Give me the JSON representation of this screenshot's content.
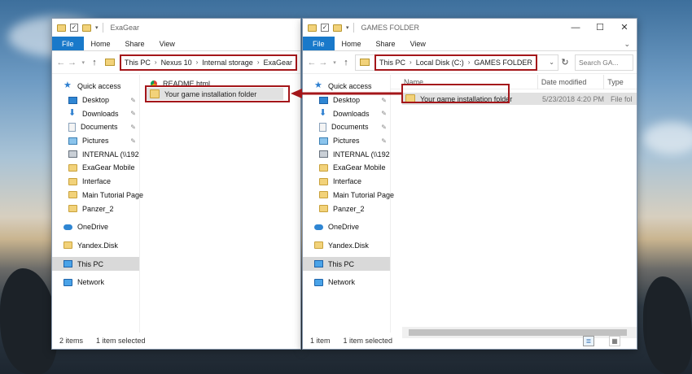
{
  "left_window": {
    "title": "ExaGear",
    "ribbon_tabs": [
      "File",
      "Home",
      "Share",
      "View"
    ],
    "breadcrumbs": [
      "This PC",
      "Nexus 10",
      "Internal storage",
      "ExaGear"
    ],
    "nav_items": [
      {
        "label": "Quick access",
        "icon": "star-icon"
      },
      {
        "label": "Desktop",
        "icon": "desktop-icon",
        "pinned": true
      },
      {
        "label": "Downloads",
        "icon": "download-icon",
        "pinned": true
      },
      {
        "label": "Documents",
        "icon": "documents-icon",
        "pinned": true
      },
      {
        "label": "Pictures",
        "icon": "pictures-icon",
        "pinned": true
      },
      {
        "label": "INTERNAL (\\\\192",
        "icon": "network-drive-icon",
        "pinned": true
      },
      {
        "label": "ExaGear Mobile",
        "icon": "folder-icon"
      },
      {
        "label": "Interface",
        "icon": "folder-icon"
      },
      {
        "label": "Main Tutorial Page",
        "icon": "folder-icon"
      },
      {
        "label": "Panzer_2",
        "icon": "folder-icon"
      },
      {
        "label": "OneDrive",
        "icon": "onedrive-icon"
      },
      {
        "label": "Yandex.Disk",
        "icon": "folder-icon"
      },
      {
        "label": "This PC",
        "icon": "pc-icon",
        "selected": true
      },
      {
        "label": "Network",
        "icon": "network-icon"
      }
    ],
    "files": [
      {
        "name": "README.html",
        "icon": "html-file-icon"
      },
      {
        "name": "Your game installation folder",
        "icon": "folder-icon",
        "selected": true
      }
    ],
    "status": {
      "count": "2 items",
      "selected": "1 item selected"
    }
  },
  "right_window": {
    "title": "GAMES FOLDER",
    "ribbon_tabs": [
      "File",
      "Home",
      "Share",
      "View"
    ],
    "breadcrumbs": [
      "This PC",
      "Local Disk (C:)",
      "GAMES FOLDER"
    ],
    "search_placeholder": "Search GA...",
    "columns": [
      "Name",
      "Date modified",
      "Type"
    ],
    "nav_items": [
      {
        "label": "Quick access",
        "icon": "star-icon"
      },
      {
        "label": "Desktop",
        "icon": "desktop-icon",
        "pinned": true
      },
      {
        "label": "Downloads",
        "icon": "download-icon",
        "pinned": true
      },
      {
        "label": "Documents",
        "icon": "documents-icon",
        "pinned": true
      },
      {
        "label": "Pictures",
        "icon": "pictures-icon",
        "pinned": true
      },
      {
        "label": "INTERNAL (\\\\192",
        "icon": "network-drive-icon",
        "pinned": true
      },
      {
        "label": "ExaGear Mobile",
        "icon": "folder-icon"
      },
      {
        "label": "Interface",
        "icon": "folder-icon"
      },
      {
        "label": "Main Tutorial Page",
        "icon": "folder-icon"
      },
      {
        "label": "Panzer_2",
        "icon": "folder-icon"
      },
      {
        "label": "OneDrive",
        "icon": "onedrive-icon"
      },
      {
        "label": "Yandex.Disk",
        "icon": "folder-icon"
      },
      {
        "label": "This PC",
        "icon": "pc-icon",
        "selected": true
      },
      {
        "label": "Network",
        "icon": "network-icon"
      }
    ],
    "files": [
      {
        "name": "Your game installation folder",
        "date": "5/23/2018 4:20 PM",
        "type": "File fol",
        "selected": true
      }
    ],
    "status": {
      "count": "1 item",
      "selected": "1 item selected"
    }
  },
  "colors": {
    "highlight_red": "#a4161a",
    "file_tab_blue": "#1979ca"
  }
}
